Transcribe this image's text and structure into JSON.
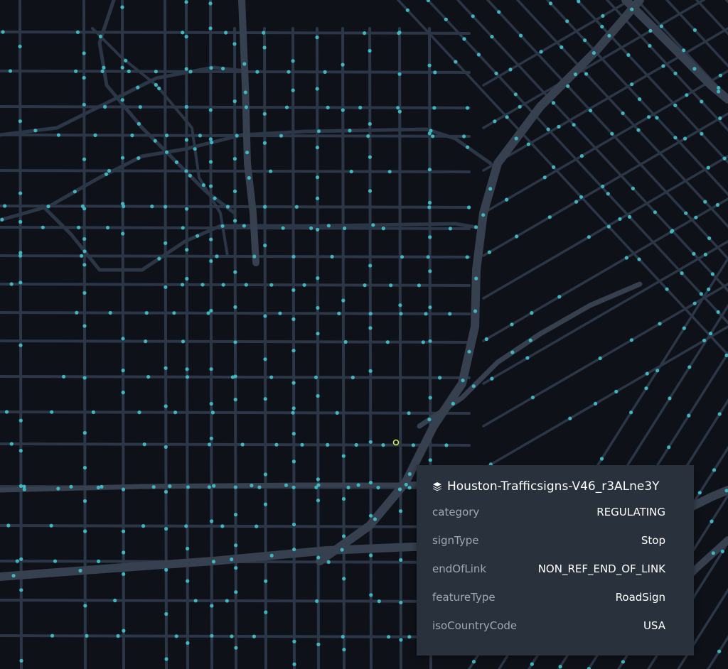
{
  "map": {
    "background": "#0f1119",
    "road_color": "#2b3646",
    "highway_color": "#36404f",
    "point_color": "#3fb6c0",
    "selected_point_color": "#d6ed47"
  },
  "tooltip": {
    "layer_icon": "layers-icon",
    "layer_name": "Houston-Trafficsigns-V46_r3ALne3Y",
    "rows": [
      {
        "key": "category",
        "value": "REGULATING"
      },
      {
        "key": "signType",
        "value": "Stop"
      },
      {
        "key": "endOfLink",
        "value": "NON_REF_END_OF_LINK"
      },
      {
        "key": "featureType",
        "value": "RoadSign"
      },
      {
        "key": "isoCountryCode",
        "value": "USA"
      }
    ]
  }
}
